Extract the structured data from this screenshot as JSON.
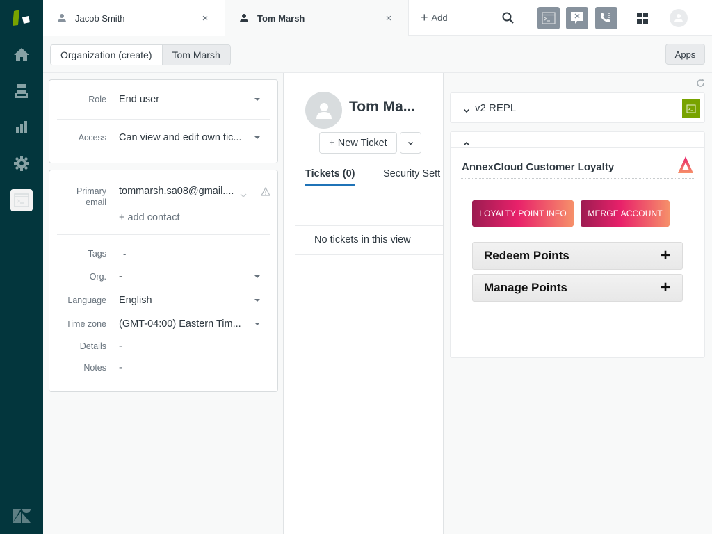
{
  "tabs": [
    {
      "label": "Jacob Smith",
      "icon": "person-icon",
      "close": "×"
    },
    {
      "label": "Tom Marsh",
      "icon": "person-icon",
      "close": "×"
    }
  ],
  "topbar": {
    "add_label": "Add",
    "icons": [
      "search-icon",
      "console-icon",
      "chat-closed-icon",
      "phone-icon",
      "grid-icon",
      "avatar-icon"
    ]
  },
  "nav": {
    "items": [
      "home-icon",
      "views-icon",
      "reporting-icon",
      "admin-gear-icon",
      "console-app-icon"
    ]
  },
  "breadcrumb": [
    "Organization (create)",
    "Tom Marsh"
  ],
  "apps_button": "Apps",
  "user_props": {
    "role": {
      "label": "Role",
      "value": "End user"
    },
    "access": {
      "label": "Access",
      "value": "Can view and edit own tic..."
    },
    "primary_email": {
      "label_line1": "Primary",
      "label_line2": "email",
      "value": "tommarsh.sa08@gmail...."
    },
    "add_contact": "+ add contact",
    "tags": {
      "label": "Tags",
      "value": "-"
    },
    "org": {
      "label": "Org.",
      "value": "-"
    },
    "language": {
      "label": "Language",
      "value": "English"
    },
    "time_zone": {
      "label": "Time zone",
      "value": "(GMT-04:00) Eastern Tim..."
    },
    "details": {
      "label": "Details",
      "value": "-"
    },
    "notes": {
      "label": "Notes",
      "value": "-"
    }
  },
  "user_header": {
    "name": "Tom Ma...",
    "new_ticket": "+ New Ticket"
  },
  "user_tabs": [
    {
      "label": "Tickets (0)",
      "active": true
    },
    {
      "label": "Security Sett",
      "active": false
    }
  ],
  "empty_state": "No tickets in this view",
  "apps_panel": {
    "repl_title": "v2 REPL",
    "annex_title": "AnnexCloud Customer Loyalty",
    "buttons": [
      "LOYALTY POINT INFO",
      "MERGE ACCOUNT"
    ],
    "accordions": [
      {
        "label": "Redeem Points",
        "icon": "+"
      },
      {
        "label": "Manage Points",
        "icon": "+"
      }
    ]
  },
  "colors": {
    "nav_bg": "#03363d",
    "accent_blue": "#1f73b7",
    "repl_green": "#78a300",
    "gradient_start": "#9c1c51",
    "gradient_mid": "#e8216a",
    "gradient_end": "#f6906a"
  }
}
